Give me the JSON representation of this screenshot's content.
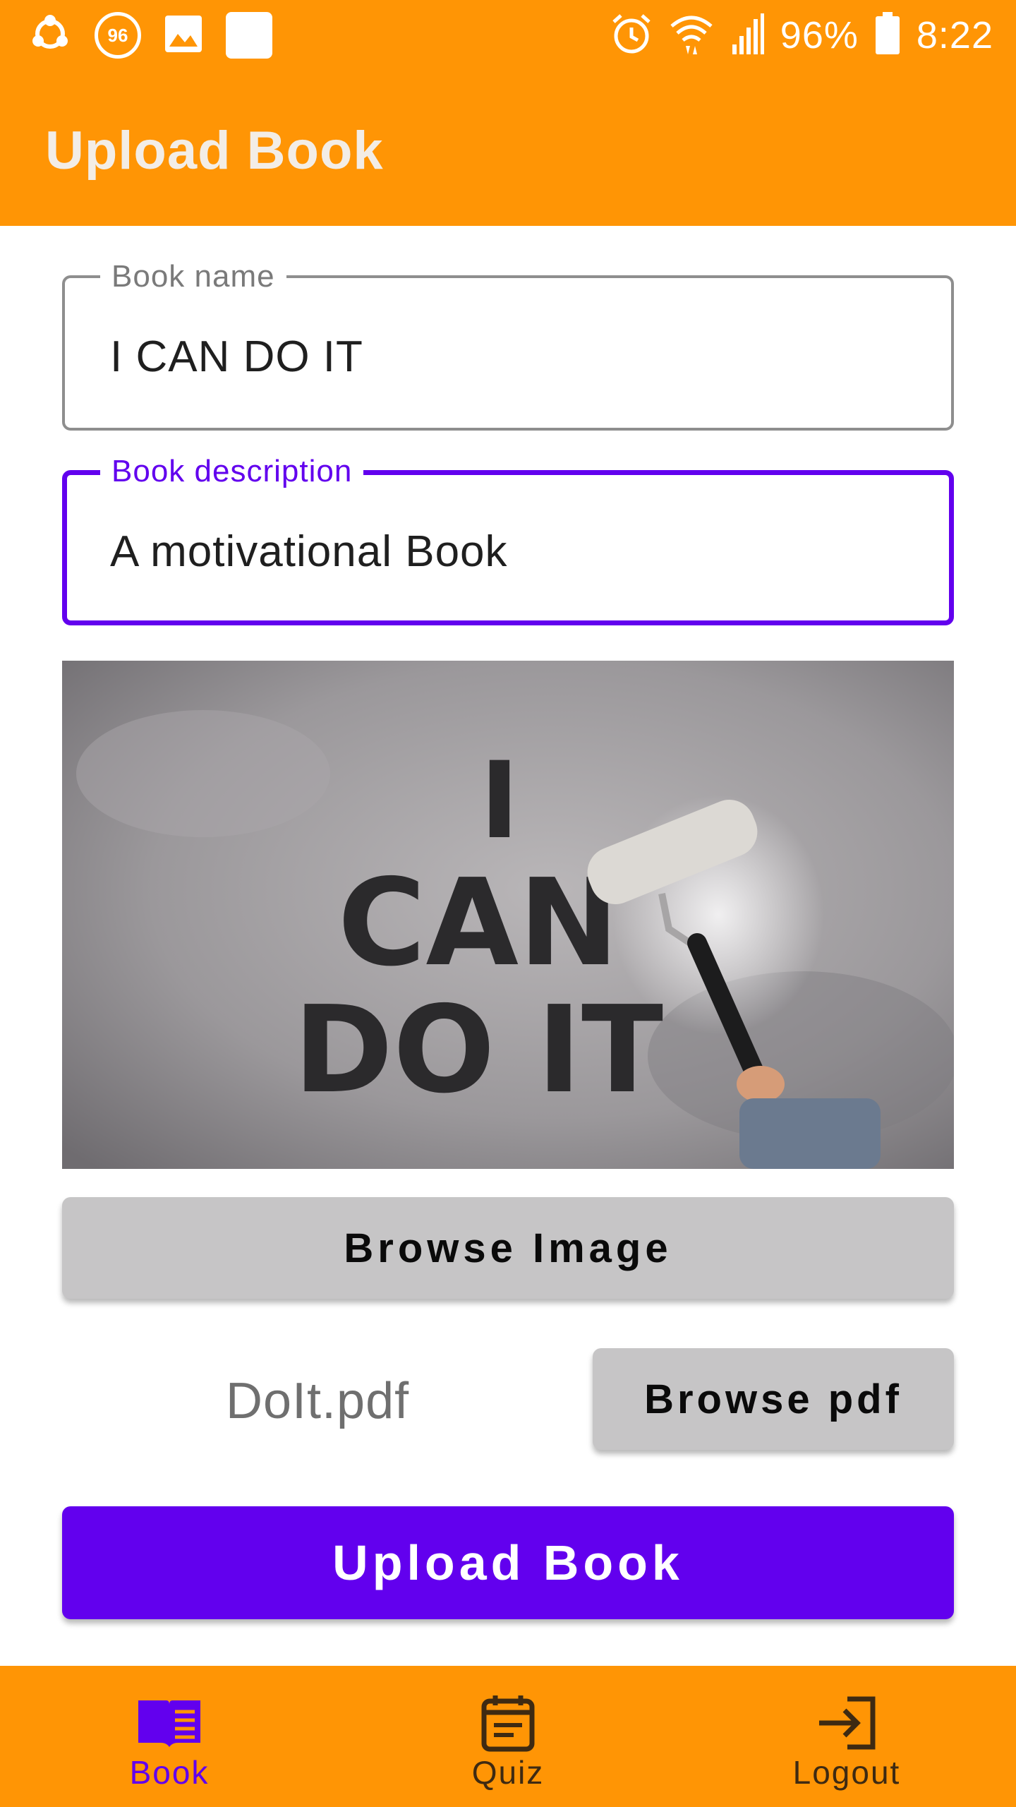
{
  "status_bar": {
    "notification_badge": "96",
    "battery": "96%",
    "time": "8:22",
    "icons": [
      "sync-icon",
      "gallery-icon",
      "blank-notification-icon",
      "alarm-icon",
      "wifi-icon",
      "signal-icon",
      "battery-icon"
    ]
  },
  "app_bar": {
    "title": "Upload Book"
  },
  "form": {
    "book_name": {
      "label": "Book name",
      "value": "I CAN DO IT"
    },
    "book_description": {
      "label": "Book description",
      "value": "A motivational Book"
    },
    "cover_image": {
      "text_lines": [
        "I",
        "CAN",
        "DO IT"
      ]
    },
    "browse_image_label": "Browse Image",
    "pdf_file_name": "DoIt.pdf",
    "browse_pdf_label": "Browse pdf",
    "upload_label": "Upload Book"
  },
  "bottom_nav": {
    "items": [
      {
        "label": "Book",
        "icon": "book-icon",
        "active": true
      },
      {
        "label": "Quiz",
        "icon": "quiz-icon",
        "active": false
      },
      {
        "label": "Logout",
        "icon": "logout-icon",
        "active": false
      }
    ]
  },
  "colors": {
    "primary_orange": "#ff9505",
    "accent_purple": "#6200ee",
    "button_gray": "#c6c5c6"
  }
}
